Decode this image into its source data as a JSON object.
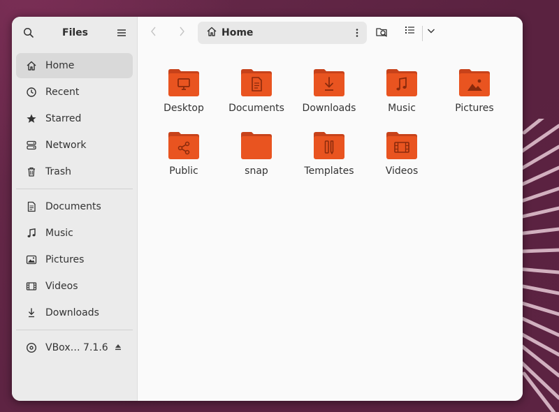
{
  "window": {
    "title": "Files"
  },
  "pathbar": {
    "location": "Home"
  },
  "sidebar": {
    "places": [
      {
        "label": "Home",
        "icon": "home-icon",
        "active": true
      },
      {
        "label": "Recent",
        "icon": "clock-icon"
      },
      {
        "label": "Starred",
        "icon": "star-icon"
      },
      {
        "label": "Network",
        "icon": "network-icon"
      },
      {
        "label": "Trash",
        "icon": "trash-icon"
      }
    ],
    "bookmarks": [
      {
        "label": "Documents",
        "icon": "document-icon"
      },
      {
        "label": "Music",
        "icon": "music-icon"
      },
      {
        "label": "Pictures",
        "icon": "picture-icon"
      },
      {
        "label": "Videos",
        "icon": "film-icon"
      },
      {
        "label": "Downloads",
        "icon": "download-icon"
      }
    ],
    "devices": [
      {
        "label": "VBox… 7.1.6",
        "icon": "disc-icon"
      }
    ]
  },
  "files": [
    {
      "name": "Desktop",
      "emblem": "monitor"
    },
    {
      "name": "Documents",
      "emblem": "document"
    },
    {
      "name": "Downloads",
      "emblem": "download"
    },
    {
      "name": "Music",
      "emblem": "music"
    },
    {
      "name": "Pictures",
      "emblem": "picture"
    },
    {
      "name": "Public",
      "emblem": "share"
    },
    {
      "name": "snap",
      "emblem": "none"
    },
    {
      "name": "Templates",
      "emblem": "template"
    },
    {
      "name": "Videos",
      "emblem": "film"
    }
  ],
  "colors": {
    "folder": "#e95420",
    "folder_dark": "#c7421a",
    "folder_emblem": "#8a2a0c",
    "desktop_bg": "#5b2341"
  }
}
